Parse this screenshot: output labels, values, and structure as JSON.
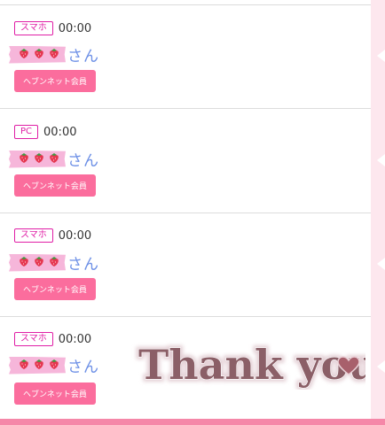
{
  "entries": [
    {
      "device": "スマホ",
      "time": "00:00",
      "suffix": "さん",
      "button": "ヘブンネット会員"
    },
    {
      "device": "PC",
      "time": "00:00",
      "suffix": "さん",
      "button": "ヘブンネット会員"
    },
    {
      "device": "スマホ",
      "time": "00:00",
      "suffix": "さん",
      "button": "ヘブンネット会員"
    },
    {
      "device": "スマホ",
      "time": "00:00",
      "suffix": "さん",
      "button": "ヘブンネット会員"
    }
  ],
  "sticker": {
    "text": "Thank you"
  },
  "icons": {
    "name_mask": "strawberry-icon",
    "heart": "heart-icon"
  },
  "colors": {
    "accent_pink": "#fb6d9d",
    "badge_magenta": "#e01fa6",
    "name_blue": "#6c8fe6",
    "tape_pink": "#f6b6da"
  }
}
